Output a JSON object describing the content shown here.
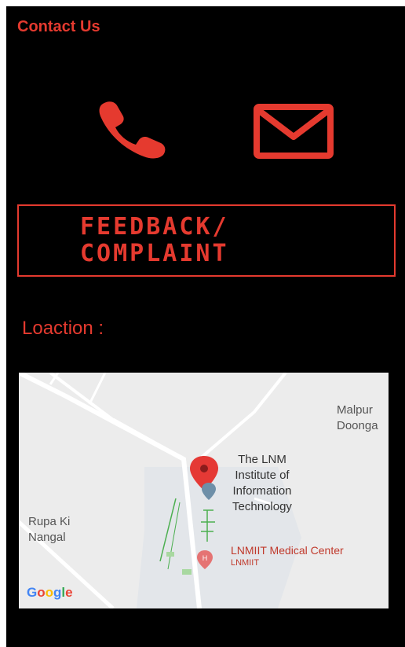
{
  "header": {
    "title": "Contact Us"
  },
  "actions": {
    "call_icon": "phone-icon",
    "email_icon": "mail-icon"
  },
  "feedback": {
    "line1": "FEEDBACK/",
    "line2": "COMPLAINT"
  },
  "location": {
    "label": "Loaction :"
  },
  "map": {
    "place_left": [
      "Rupa Ki",
      "Nangal"
    ],
    "place_right": [
      "Malpur",
      "Doonga"
    ],
    "poi_main": [
      "The LNM",
      "Institute of",
      "Information",
      "Technology"
    ],
    "poi_medical": "LNMIIT Medical Center",
    "poi_medical_sub": "LNMIIT",
    "logo": "Google"
  },
  "colors": {
    "accent": "#e53a2f",
    "background": "#000000",
    "map_bg": "#ececec"
  }
}
